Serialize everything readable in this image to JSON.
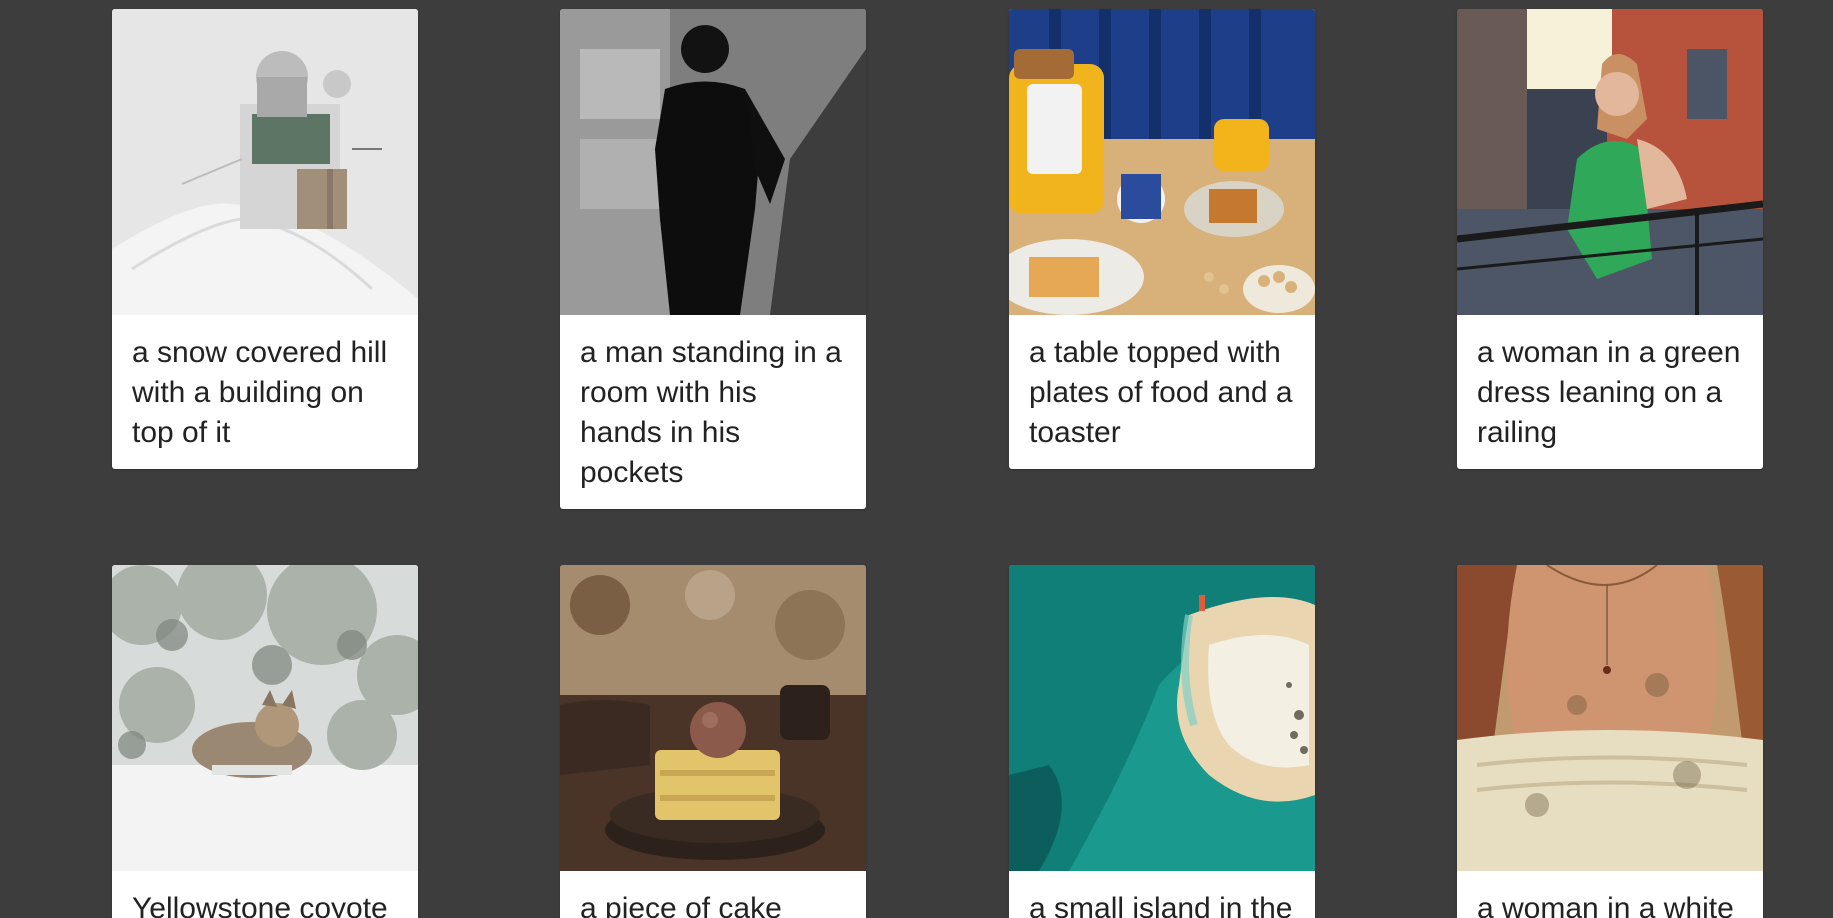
{
  "cards": [
    {
      "caption": "a snow covered hill with a building on top of it"
    },
    {
      "caption": "a man standing in a room with his hands in his pockets"
    },
    {
      "caption": "a table topped with plates of food and a toaster"
    },
    {
      "caption": "a woman in a green dress leaning on a railing"
    },
    {
      "caption": "Yellowstone coyote"
    },
    {
      "caption": "a piece of cake"
    },
    {
      "caption": "a small island in the"
    },
    {
      "caption": "a woman in a white"
    }
  ],
  "colors": {
    "background": "#3d3d3d",
    "card": "#ffffff",
    "text": "#222222"
  }
}
